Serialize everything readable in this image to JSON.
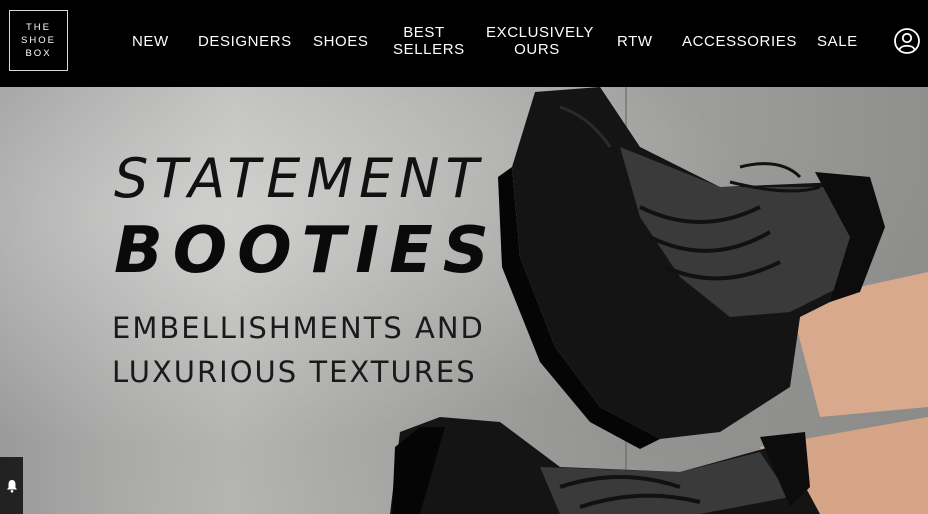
{
  "logo": {
    "line1": "THE",
    "line2": "SHOE",
    "line3": "BOX"
  },
  "nav": {
    "new": "NEW",
    "designers": "DESIGNERS",
    "shoes": "SHOES",
    "best_sellers_1": "BEST",
    "best_sellers_2": "SELLERS",
    "exclusively_1": "EXCLUSIVELY",
    "exclusively_2": "OURS",
    "rtw": "RTW",
    "accessories": "ACCESSORIES",
    "sale": "SALE"
  },
  "icons": {
    "account": "user-icon",
    "notification": "bell-icon"
  },
  "hero": {
    "headline_1": "STATEMENT",
    "headline_2": "BOOTIES",
    "subline_1": "EMBELLISHMENTS AND",
    "subline_2": "LUXURIOUS TEXTURES"
  }
}
